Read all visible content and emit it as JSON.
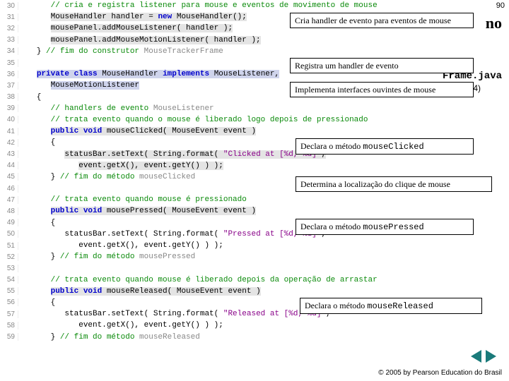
{
  "page_number": "90",
  "right_title_tail": "no",
  "right_sub": "Frame.java",
  "right_sub2": "(2 de 4)",
  "footer": "© 2005 by Pearson Education do Brasil",
  "callouts": {
    "c1": "Cria handler de evento para eventos de mouse",
    "c2": "Registra um handler de evento",
    "c3": "Implementa interfaces ouvintes de mouse",
    "c4a": "Declara o método ",
    "c4b": "mouseClicked",
    "c5": "Determina a localização do clique de mouse",
    "c6a": "Declara o método ",
    "c6b": "mousePressed",
    "c7a": "Declara o método ",
    "c7b": "mouseReleased"
  },
  "lines": [
    {
      "n": "30",
      "html": "      <span class='cm'>// cria e registra listener para mouse e eventos de movimento de mouse</span>"
    },
    {
      "n": "31",
      "html": "      <span class='hl'>MouseHandler handler = </span><span class='kw hl'>new</span><span class='hl'> MouseHandler();</span>"
    },
    {
      "n": "32",
      "html": "      <span class='hl'>mousePanel.addMouseListener( handler );</span>"
    },
    {
      "n": "33",
      "html": "      <span class='hl'>mousePanel.addMouseMotionListener( handler );</span>"
    },
    {
      "n": "34",
      "html": "   } <span class='cm'>// fim do construtor </span><span class='cm s'>MouseTrackerFrame</span>"
    },
    {
      "n": "35",
      "html": ""
    },
    {
      "n": "36",
      "html": "   <span class='kw hlb'>private</span><span class='hlb'> </span><span class='kw hlb'>class</span><span class='hlb'> MouseHandler </span><span class='kw hlb'>implements</span><span class='hlb'> MouseListener,</span>"
    },
    {
      "n": "37",
      "html": "      <span class='hlb'>MouseMotionListener</span>"
    },
    {
      "n": "38",
      "html": "   {"
    },
    {
      "n": "39",
      "html": "      <span class='cm'>// handlers de evento </span><span class='cm s'>MouseListener</span>"
    },
    {
      "n": "40",
      "html": "      <span class='cm'>// trata evento quando o mouse é liberado logo depois de pressionado</span>"
    },
    {
      "n": "41",
      "html": "      <span class='kw hl'>public</span><span class='hl'> </span><span class='kw hl'>void</span><span class='hl'> mouseClicked( MouseEvent event )</span>"
    },
    {
      "n": "42",
      "html": "      {"
    },
    {
      "n": "43",
      "html": "         <span class='hl'>statusBar.setText( String.format( </span><span class='str hl'>\"Clicked at [%d, %d]\"</span><span class='hl'>,</span>"
    },
    {
      "n": "44",
      "html": "            <span class='hl'>event.getX(), event.getY() ) );</span>"
    },
    {
      "n": "45",
      "html": "      } <span class='cm'>// fim do método </span><span class='cm s'>mouseClicked</span>"
    },
    {
      "n": "46",
      "html": ""
    },
    {
      "n": "47",
      "html": "      <span class='cm'>// trata evento quando mouse é pressionado</span>"
    },
    {
      "n": "48",
      "html": "      <span class='kw hl'>public</span><span class='hl'> </span><span class='kw hl'>void</span><span class='hl'> mousePressed( MouseEvent event )</span>"
    },
    {
      "n": "49",
      "html": "      {"
    },
    {
      "n": "50",
      "html": "         statusBar.setText( String.format( <span class='str'>\"Pressed at [%d, %d]\"</span>,"
    },
    {
      "n": "51",
      "html": "            event.getX(), event.getY() ) );"
    },
    {
      "n": "52",
      "html": "      } <span class='cm'>// fim do método </span><span class='cm s'>mousePressed</span>"
    },
    {
      "n": "53",
      "html": ""
    },
    {
      "n": "54",
      "html": "      <span class='cm'>// trata evento quando mouse é liberado depois da operação de arrastar</span>"
    },
    {
      "n": "55",
      "html": "      <span class='kw hl'>public</span><span class='hl'> </span><span class='kw hl'>void</span><span class='hl'> mouseReleased( MouseEvent event )</span>"
    },
    {
      "n": "56",
      "html": "      {"
    },
    {
      "n": "57",
      "html": "         statusBar.setText( String.format( <span class='str'>\"Released at [%d, %d]\"</span>,"
    },
    {
      "n": "58",
      "html": "            event.getX(), event.getY() ) );"
    },
    {
      "n": "59",
      "html": "      } <span class='cm'>// fim do método </span><span class='cm s'>mouseReleased</span>"
    }
  ]
}
